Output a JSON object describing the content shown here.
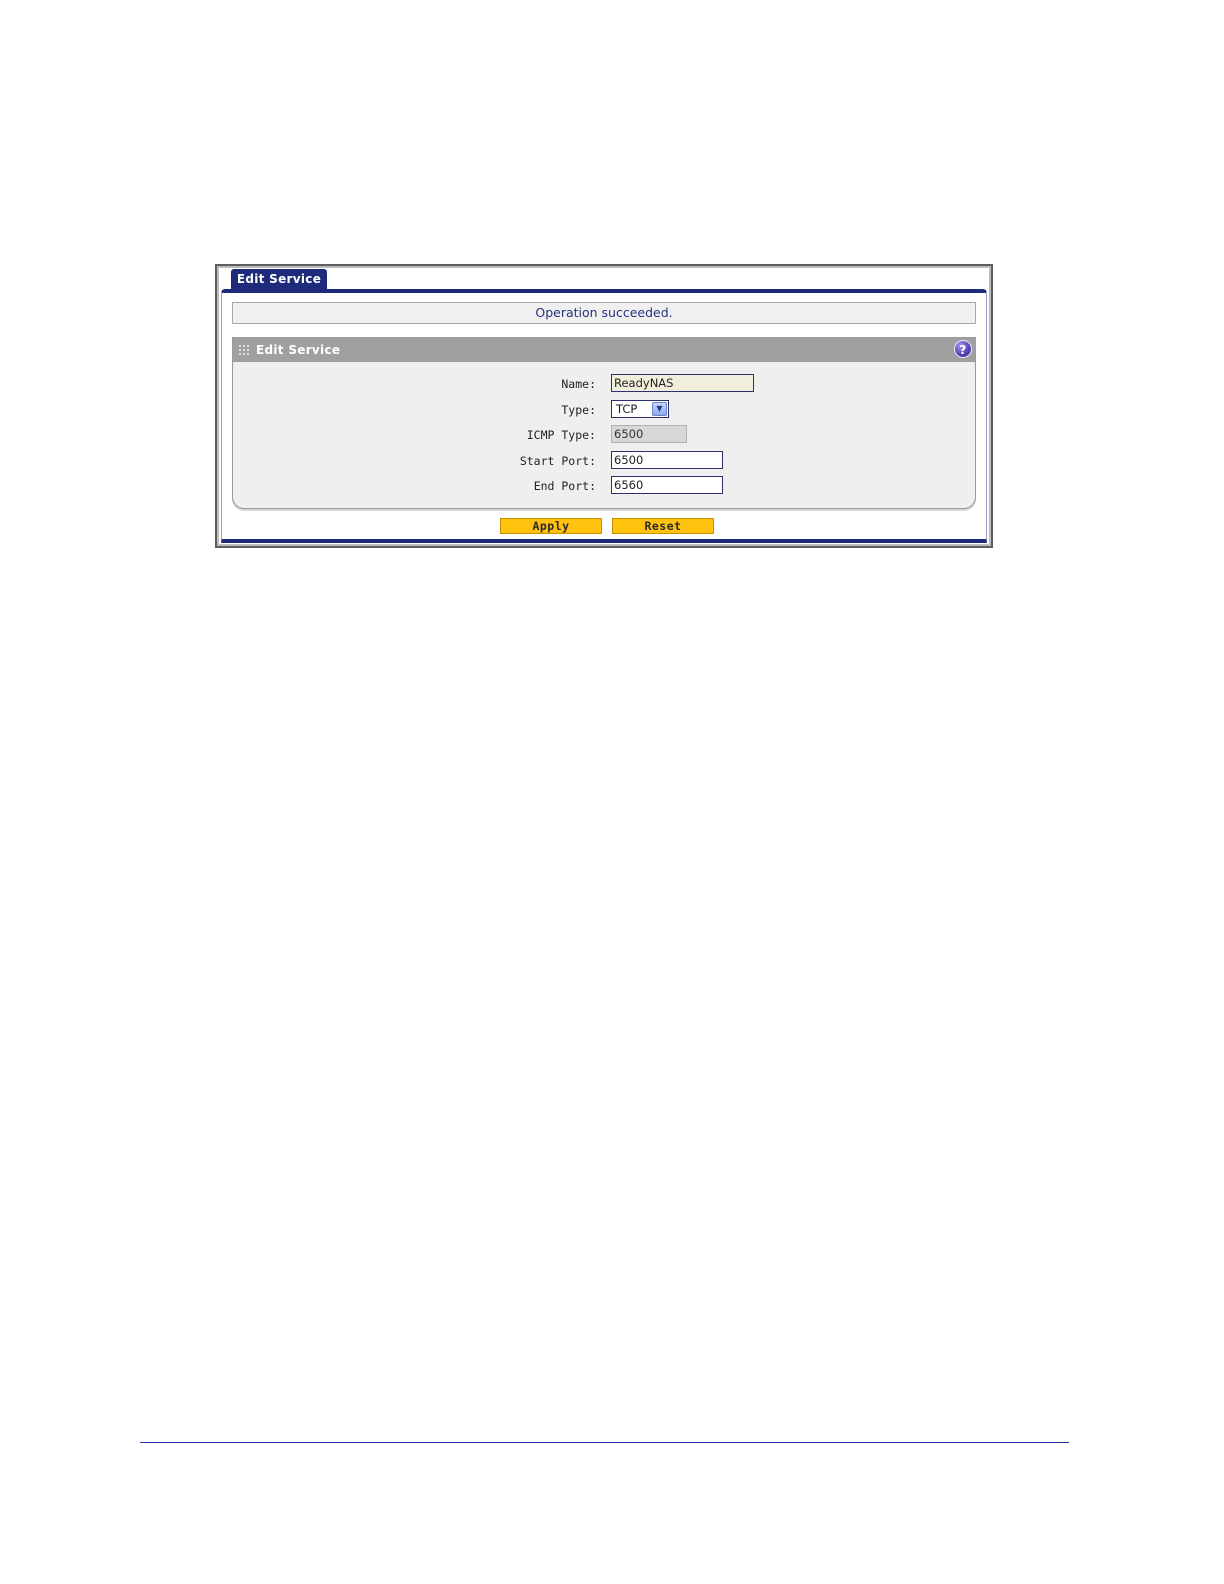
{
  "tab": {
    "label": "Edit Service"
  },
  "status": {
    "message": "Operation succeeded."
  },
  "section": {
    "title": "Edit Service",
    "help_glyph": "?"
  },
  "form": {
    "name": {
      "label": "Name:",
      "value": "ReadyNAS"
    },
    "type": {
      "label": "Type:",
      "value": "TCP"
    },
    "icmp_type": {
      "label": "ICMP Type:",
      "value": "6500"
    },
    "start_port": {
      "label": "Start Port:",
      "value": "6500"
    },
    "end_port": {
      "label": "End Port:",
      "value": "6560"
    }
  },
  "buttons": {
    "apply": "Apply",
    "reset": "Reset"
  },
  "icons": {
    "help": "help-icon",
    "grip": "grip-icon",
    "dropdown": "chevron-down-icon"
  },
  "colors": {
    "tab_bg": "#1e2a7a",
    "section_header": "#a0a0a0",
    "button_bg": "#ffc20e",
    "status_text": "#273280"
  }
}
